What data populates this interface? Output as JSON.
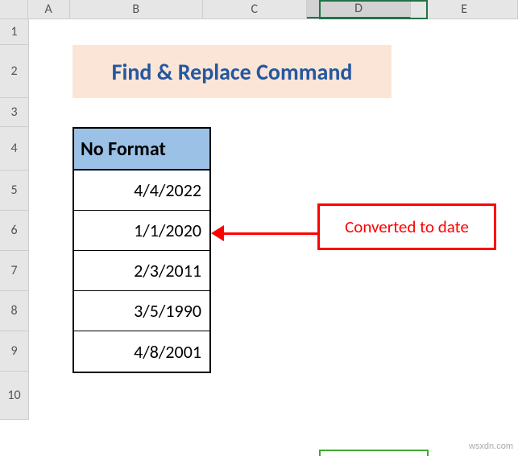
{
  "columns": [
    "A",
    "B",
    "C",
    "D",
    "E"
  ],
  "rows": [
    "1",
    "2",
    "3",
    "4",
    "5",
    "6",
    "7",
    "8",
    "9",
    "10"
  ],
  "selected_column": "D",
  "title": "Find & Replace Command",
  "table": {
    "header": "No Format",
    "values": [
      "4/4/2022",
      "1/1/2020",
      "2/3/2011",
      "3/5/1990",
      "4/8/2001"
    ]
  },
  "callout": "Converted to date",
  "watermark": "wsxdn.com"
}
